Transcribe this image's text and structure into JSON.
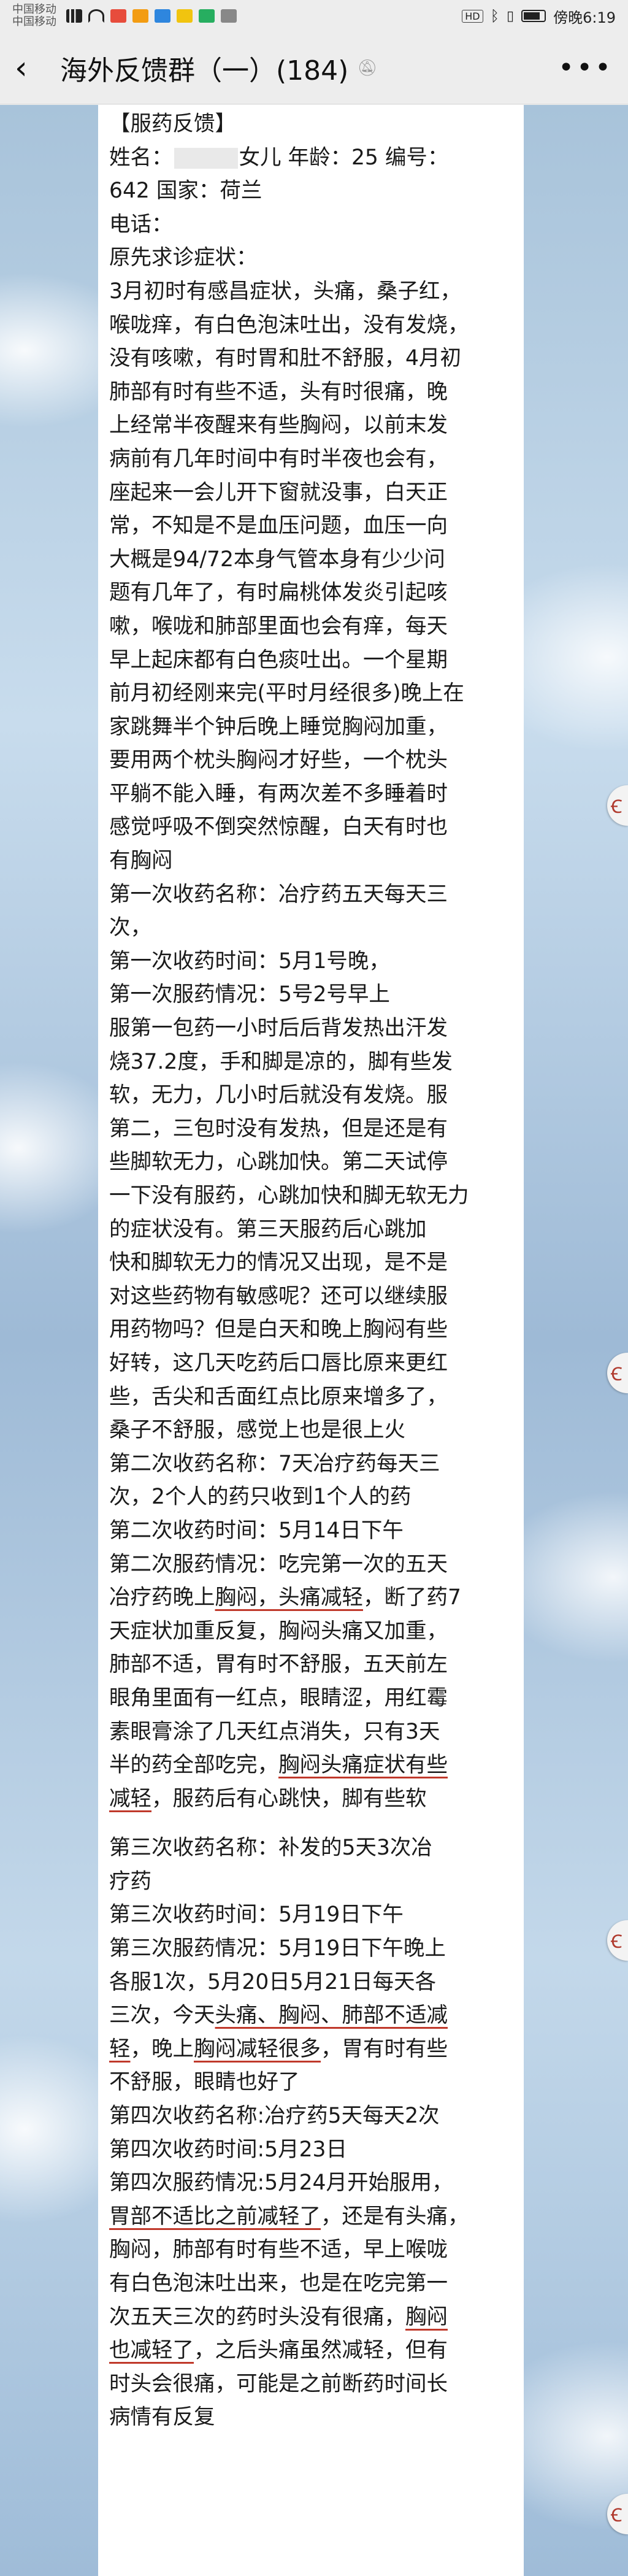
{
  "status_bar": {
    "carrier_1": "中国移动",
    "carrier_2": "中国移动",
    "hd": "HD",
    "time": "傍晚6:19"
  },
  "nav": {
    "title": "海外反馈群（一）(184)"
  },
  "side_marker": "Ꞓ",
  "note": {
    "lines": [
      {
        "t": "【服药反馈】"
      },
      {
        "pre": "姓名：",
        "mask": true,
        "post": "女儿 年龄：25    编号："
      },
      {
        "t": "642      国家：荷兰"
      },
      {
        "t": "电话："
      },
      {
        "t": "原先求诊症状："
      },
      {
        "t": "3月初时有感昌症状，头痛，桑子红，"
      },
      {
        "t": "喉咙痒，有白色泡沫吐出，没有发烧，"
      },
      {
        "t": "没有咳嗽，有时胃和肚不舒服，4月初"
      },
      {
        "t": "肺部有时有些不适，头有时很痛，晚"
      },
      {
        "t": "上经常半夜醒来有些胸闷，以前末发"
      },
      {
        "t": "病前有几年时间中有时半夜也会有，"
      },
      {
        "t": "座起来一会儿开下窗就没事，白天正"
      },
      {
        "t": "常，不知是不是血压问题，血压一向"
      },
      {
        "t": "大概是94/72本身气管本身有少少问"
      },
      {
        "t": "题有几年了，有时扁桃体发炎引起咳"
      },
      {
        "t": "嗽，喉咙和肺部里面也会有痒，每天"
      },
      {
        "t": "早上起床都有白色痰吐出。一个星期"
      },
      {
        "t": "前月初经刚来完(平时月经很多)晚上在"
      },
      {
        "t": "家跳舞半个钟后晚上睡觉胸闷加重，"
      },
      {
        "t": "要用两个枕头胸闷才好些，一个枕头"
      },
      {
        "t": "平躺不能入睡，有两次差不多睡着时"
      },
      {
        "t": "感觉呼吸不倒突然惊醒，白天有时也"
      },
      {
        "t": "有胸闷"
      },
      {
        "t": "第一次收药名称：冶疗药五天每天三"
      },
      {
        "t": "次，"
      },
      {
        "t": "第一次收药时间：5月1号晚，"
      },
      {
        "t": "第一次服药情况：5号2号早上"
      },
      {
        "t": "服第一包药一小时后后背发热出汗发"
      },
      {
        "t": "烧37.2度，手和脚是凉的，脚有些发"
      },
      {
        "t": "软，无力，几小时后就没有发烧。服"
      },
      {
        "t": "第二，三包时没有发热，但是还是有"
      },
      {
        "t": "些脚软无力，心跳加快。第二天试停"
      },
      {
        "t": "一下没有服药，心跳加快和脚无软无力"
      },
      {
        "t": "的症状没有。第三天服药后心跳加"
      },
      {
        "t": "快和脚软无力的情况又出现，是不是"
      },
      {
        "t": "对这些药物有敏感呢？还可以继续服"
      },
      {
        "t": "用药物吗？但是白天和晚上胸闷有些"
      },
      {
        "t": "好转，这几天吃药后口唇比原来更红"
      },
      {
        "t": "些，舌尖和舌面红点比原来增多了，"
      },
      {
        "t": "桑子不舒服，感觉上也是很上火"
      },
      {
        "t": "第二次收药名称：7天冶疗药每天三"
      },
      {
        "t": "次，2个人的药只收到1个人的药"
      },
      {
        "t": "第二次收药时间：5月14日下午"
      },
      {
        "t": "第二次服药情况：吃完第一次的五天"
      },
      {
        "pre": "冶疗药晚上",
        "u": "胸闷，头痛减轻",
        "post": "，断了药7"
      },
      {
        "t": "天症状加重反复，胸闷头痛又加重，"
      },
      {
        "t": "肺部不适，胃有时不舒服，五天前左"
      },
      {
        "t": "眼角里面有一红点，眼睛涩，用红霉"
      },
      {
        "t": "素眼膏涂了几天红点消失，只有3天"
      },
      {
        "pre": "半的药全部吃完，",
        "u": "胸闷头痛症状有些",
        "post": ""
      },
      {
        "pre": "",
        "u": "减轻",
        "post": "，服药后有心跳快，脚有些软"
      },
      {
        "blank": true
      },
      {
        "t": "第三次收药名称：补发的5天3次冶"
      },
      {
        "t": "疗药"
      },
      {
        "t": "第三次收药时间：5月19日下午"
      },
      {
        "t": "第三次服药情况：5月19日下午晚上"
      },
      {
        "t": "各服1次，5月20日5月21日每天各"
      },
      {
        "pre": "三次，今天",
        "u": "头痛、胸闷、肺部不适减",
        "post": ""
      },
      {
        "pre": "",
        "u": "轻",
        "post": "，晚上",
        "u2": "胸闷减轻很多",
        "post2": "，胃有时有些"
      },
      {
        "t": "不舒服，眼睛也好了"
      },
      {
        "t": "第四次收药名称:冶疗药5天每天2次"
      },
      {
        "t": "第四次收药时间:5月23日"
      },
      {
        "t": "第四次服药情况:5月24月开始服用，"
      },
      {
        "pre": "",
        "u": "胃部不适比之前减轻了",
        "post": "，还是有头痛，"
      },
      {
        "t": "胸闷，肺部有时有些不适，早上喉咙"
      },
      {
        "t": "有白色泡沫吐出来，也是在吃完第一"
      },
      {
        "pre": "次五天三次的药时头没有很痛，",
        "u": "胸闷",
        "post": ""
      },
      {
        "pre": "",
        "u": "也减轻了",
        "post": "，之后头痛虽然减轻，但有"
      },
      {
        "t": "时头会很痛，可能是之前断药时间长"
      },
      {
        "t": "病情有反复"
      }
    ]
  }
}
